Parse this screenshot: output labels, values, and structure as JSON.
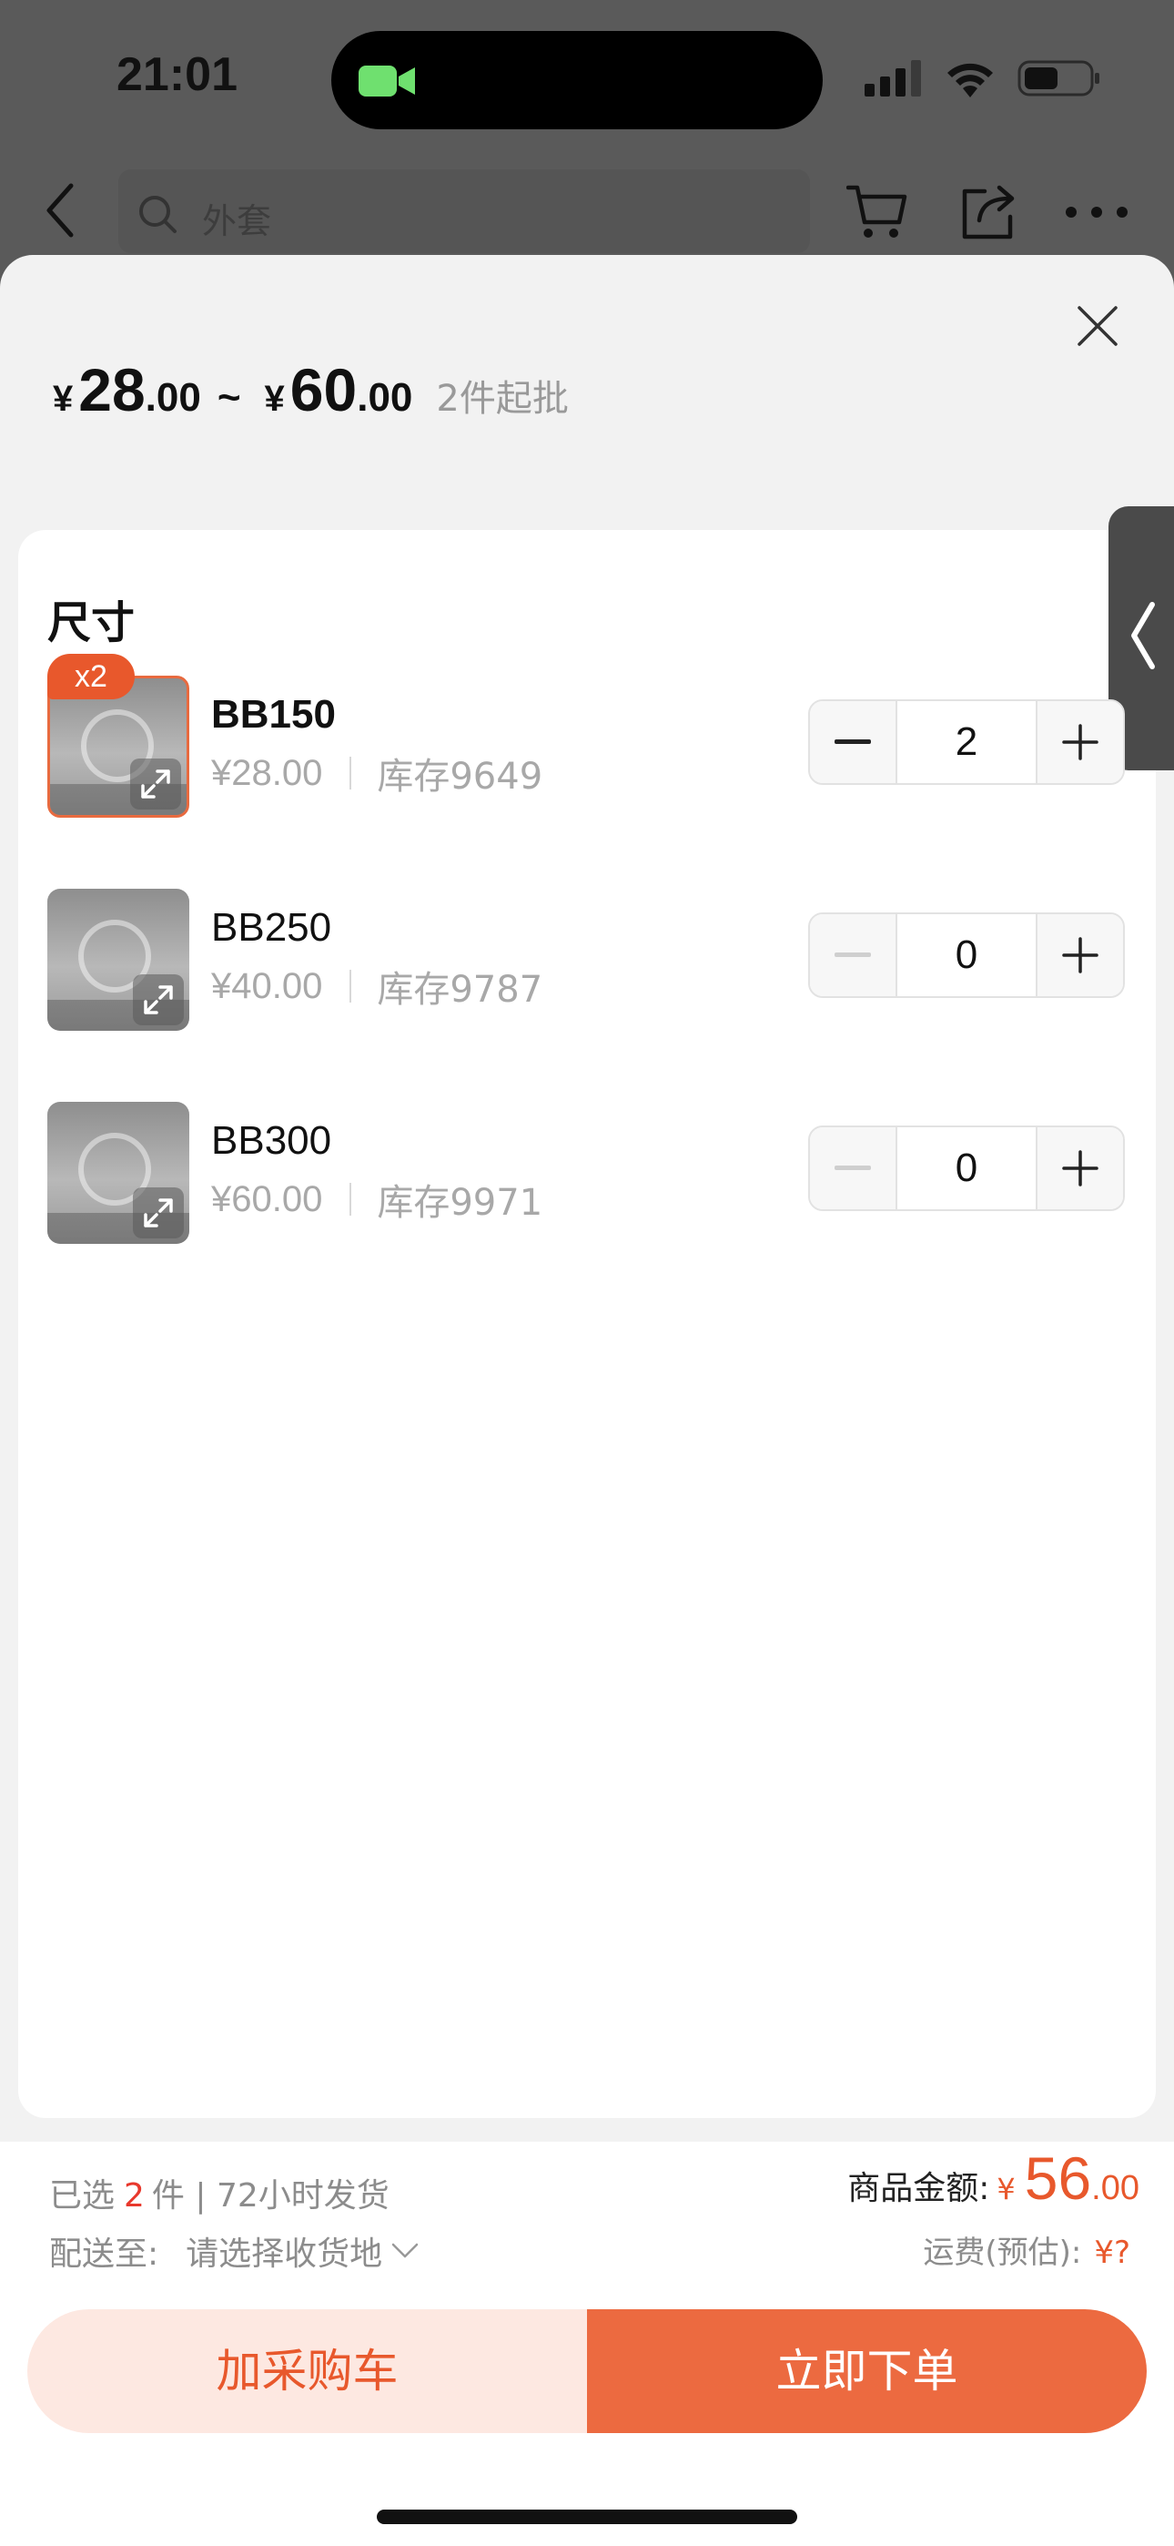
{
  "status_bar": {
    "time": "21:01"
  },
  "page_header": {
    "search_placeholder": "外套",
    "icons": [
      "back-icon",
      "search-icon",
      "cart-icon",
      "share-icon",
      "more-icon"
    ]
  },
  "sheet": {
    "price_range": {
      "currency": "¥",
      "min_int": "28",
      "min_dec": ".00",
      "separator": "~",
      "max_int": "60",
      "max_dec": ".00",
      "min_order": "2件起批"
    },
    "section_title": "尺寸",
    "skus": [
      {
        "badge": "x2",
        "name": "BB150",
        "price": "¥28.00",
        "stock": "库存9649",
        "quantity": "2",
        "selected": true
      },
      {
        "badge": "",
        "name": "BB250",
        "price": "¥40.00",
        "stock": "库存9787",
        "quantity": "0",
        "selected": false
      },
      {
        "badge": "",
        "name": "BB300",
        "price": "¥60.00",
        "stock": "库存9971",
        "quantity": "0",
        "selected": false
      }
    ]
  },
  "footer": {
    "selected_prefix": "已选",
    "selected_count": "2",
    "selected_suffix": "件 | 72小时发货",
    "ship_to_label": "配送至:",
    "ship_to_value": "请选择收货地",
    "amount_label": "商品金额:",
    "amount_currency": "¥",
    "amount_int": "56",
    "amount_dec": ".00",
    "freight_label": "运费(预估):",
    "freight_value": "¥?",
    "add_cart_label": "加采购车",
    "buy_now_label": "立即下单"
  },
  "colors": {
    "accent": "#e8582c",
    "accent_soft": "#fde8e1",
    "price_red": "#e8382c"
  }
}
